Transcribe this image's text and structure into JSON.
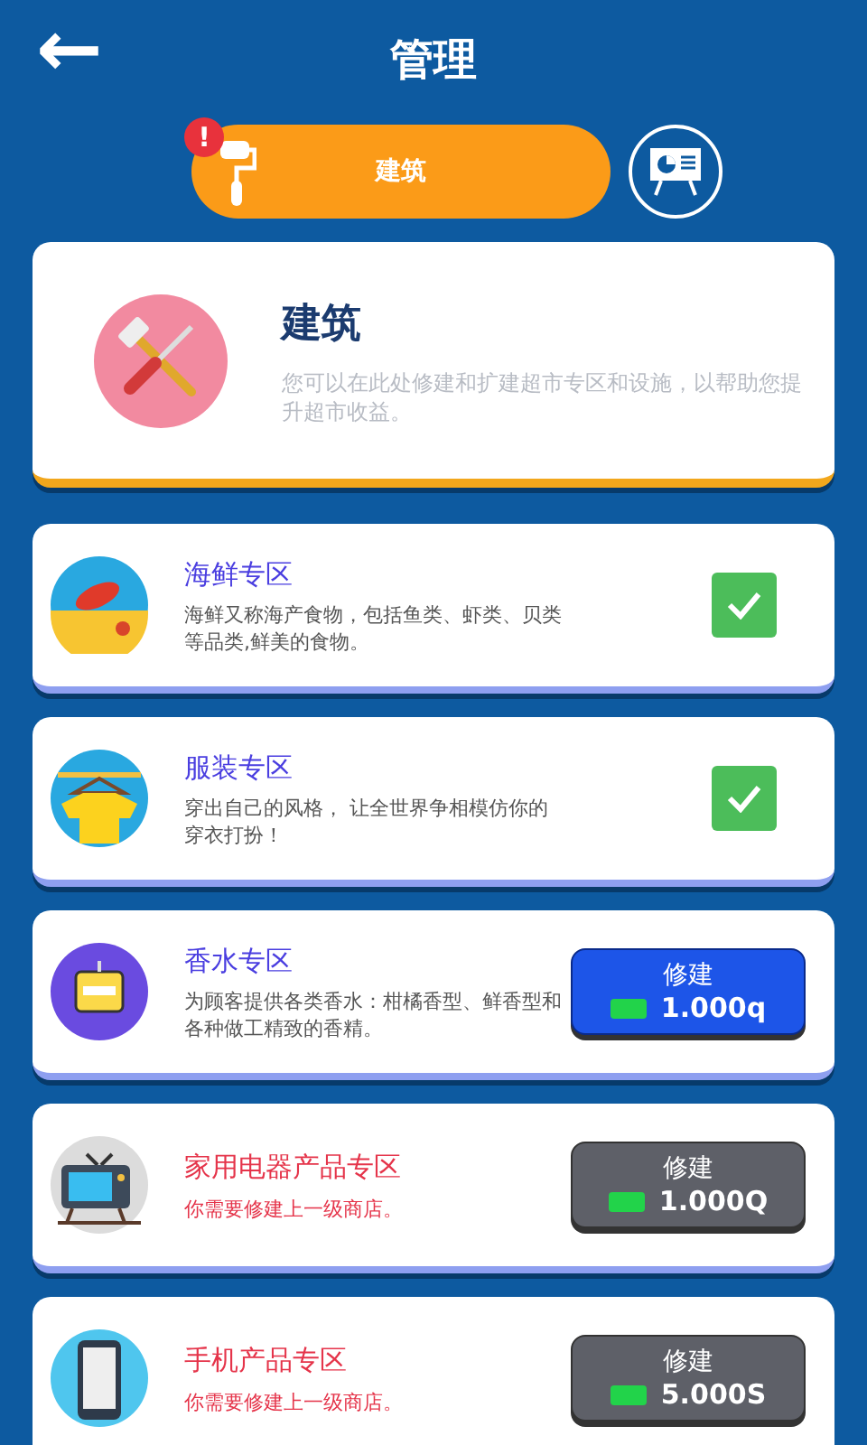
{
  "header": {
    "back": "←",
    "title": "管理"
  },
  "tabs": [
    {
      "label": "建筑",
      "selected": true,
      "badge": "!"
    },
    {
      "selected": false
    }
  ],
  "info": {
    "title": "建筑",
    "text": "您可以在此处修建和扩建超市专区和设施，以帮助您提升超市收益。"
  },
  "zones": [
    {
      "kind": "built",
      "name": "海鲜专区",
      "text": "海鲜又称海产食物，包括鱼类、虾类、贝类等品类,鲜美的食物。",
      "checked": true
    },
    {
      "kind": "built",
      "name": "服装专区",
      "text": "穿出自己的风格， 让全世界争相模仿你的穿衣打扮！",
      "checked": true
    },
    {
      "kind": "buildable",
      "name": "香水专区",
      "text": "为顾客提供各类香水：柑橘香型、鲜香型和各种做工精致的香精。",
      "button": "修建",
      "price": "1.000q"
    },
    {
      "kind": "locked",
      "name": "家用电器产品专区",
      "text": "你需要修建上一级商店。",
      "button": "修建",
      "price": "1.000Q"
    },
    {
      "kind": "locked",
      "name": "手机产品专区",
      "text": "你需要修建上一级商店。",
      "button": "修建",
      "price": "5.000S"
    }
  ]
}
